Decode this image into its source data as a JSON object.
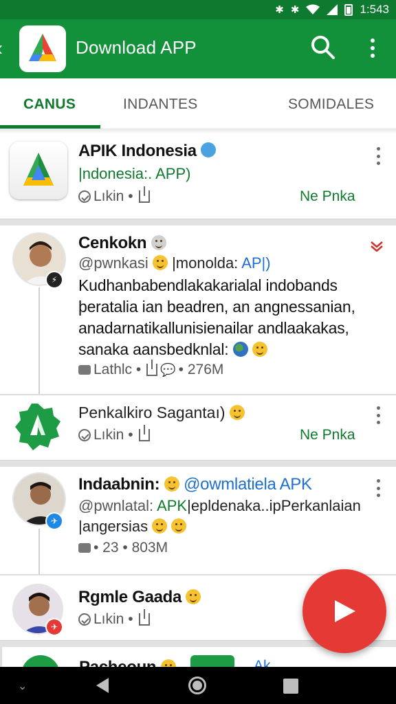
{
  "status_bar": {
    "time": "1:543",
    "icons": [
      "bluetooth-icon",
      "bluetooth-icon",
      "wifi-icon",
      "signal-icon",
      "battery-icon"
    ]
  },
  "app_bar": {
    "title": "Download APP",
    "icons": [
      "back-icon",
      "app-logo",
      "search-icon",
      "overflow-icon"
    ]
  },
  "tabs": [
    {
      "label": "CANUS",
      "active": true
    },
    {
      "label": "INDANTES",
      "active": false
    },
    {
      "label": "SOMIDALES",
      "active": false
    }
  ],
  "feed": [
    {
      "title": "APIK Indonesia",
      "subtitle": "|ndonesia:. APP)",
      "meta_label": "Lıkin •",
      "action_label": "Ne Pnka"
    },
    {
      "title": "Cenkokn",
      "handle": "@pwnkasi",
      "handle_tail": "|monolda:",
      "handle_link": "AP|)",
      "body": "Kudhanbabendlakakarialal indobands þeratalia ian beadren, an angnessanian, anadarnatikallunisienailar andlaakakas, sanaka aansbedknlal:",
      "meta_label": "Lathlc •",
      "meta_count": "• 276M"
    },
    {
      "title": "Penkalkiro Sagantaı)",
      "meta_label": "Lıkin •",
      "action_label": "Ne Pnka"
    },
    {
      "title": "Indaabnin:",
      "title_link": "@owmla",
      "title_tail": "tiela APK",
      "handle": "@pwnlatal:",
      "handle_link": "APK",
      "handle_tail": "|epldenaka..ipPerkanlaian",
      "body": "|angersias",
      "meta_count": "• 23 • 803M"
    },
    {
      "title": "Rgmle Gaada",
      "meta_label": "Lıkin •"
    },
    {
      "title": "Pacheoun",
      "tail": "Ak"
    }
  ],
  "fab": {
    "icon": "play-icon"
  },
  "nav_bar": {
    "icons": [
      "hide-keyboard-icon",
      "back-icon",
      "home-icon",
      "recents-icon"
    ]
  },
  "colors": {
    "primary": "#13913a",
    "status_bar": "#0e7a2f",
    "accent_red": "#e53935",
    "tab_active": "#0f7a2d",
    "link_blue": "#1e6fd0"
  }
}
